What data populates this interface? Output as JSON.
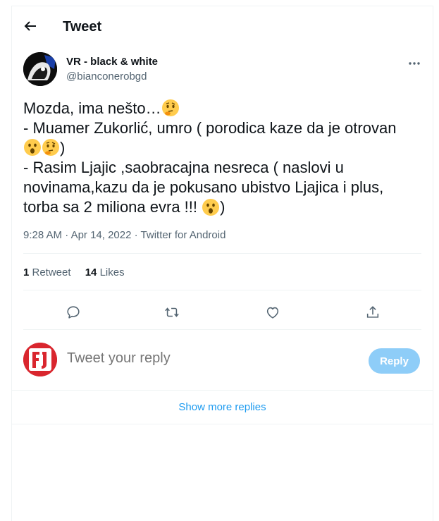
{
  "header": {
    "title": "Tweet",
    "back_icon": "arrow-left-icon"
  },
  "author": {
    "name": "VR - black & white",
    "handle": "@bianconerobgd"
  },
  "tweet": {
    "line1": "Mozda, ima nešto…",
    "line2": "- Muamer Zukorlić, umro ( porodica kaze da je otrovan",
    "line3_end": ")",
    "line4": "- Rasim Ljajic ,saobracajna nesreca ( naslovi u",
    "line5": "novinama,kazu da je pokusano ubistvo Ljajica i plus,",
    "line6": "torba sa 2 miliona evra !!!",
    "line6_end": ")",
    "emojis": [
      "thinking-face",
      "astonished-face",
      "thinking-face",
      "astonished-face"
    ]
  },
  "meta": {
    "time": "9:28 AM",
    "sep1": " · ",
    "date": "Apr 14, 2022",
    "sep2": " · ",
    "source": "Twitter for Android"
  },
  "stats": {
    "retweets_count": "1",
    "retweets_label": " Retweet",
    "likes_count": "14",
    "likes_label": " Likes"
  },
  "actions": [
    "reply-icon",
    "retweet-icon",
    "like-icon",
    "share-icon"
  ],
  "reply": {
    "placeholder": "Tweet your reply",
    "button": "Reply"
  },
  "show_more": "Show more replies",
  "colors": {
    "accent": "#1d9bf0",
    "reply_button_disabled": "#8ecdf8",
    "secondary_text": "#536471"
  }
}
